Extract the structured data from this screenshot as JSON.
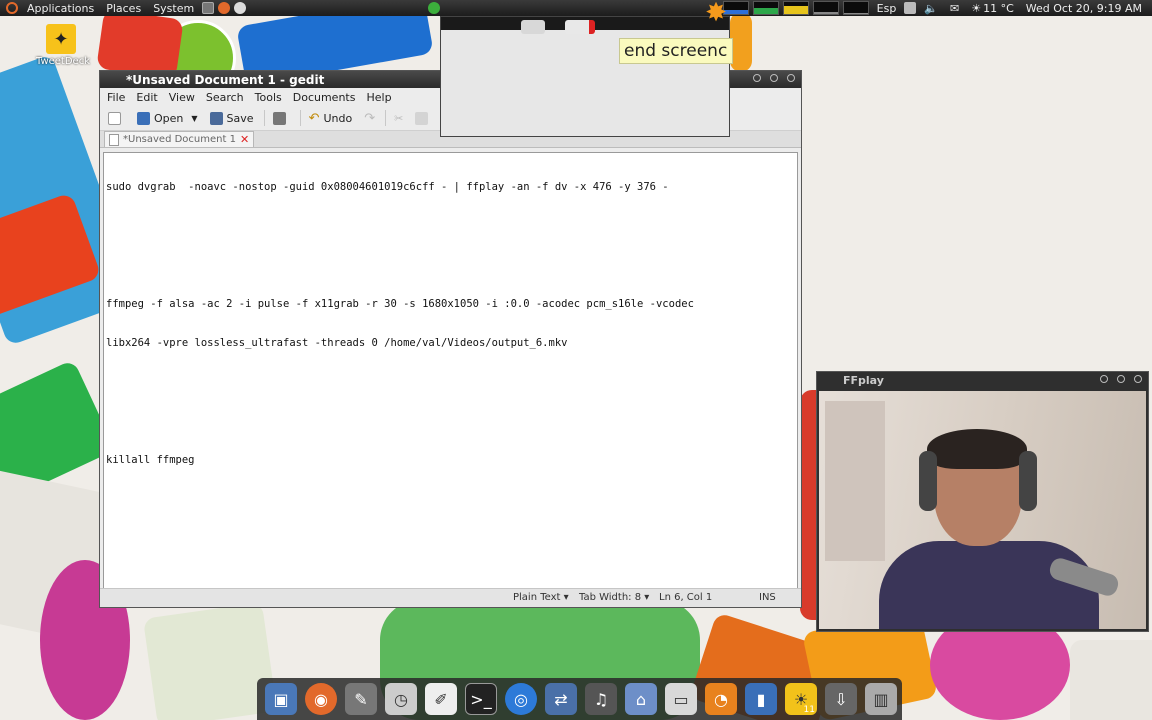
{
  "top_panel": {
    "menus": [
      "Applications",
      "Places",
      "System"
    ],
    "keyboard_layout": "Esp",
    "weather": "11 °C",
    "datetime": "Wed Oct 20,  9:19 AM"
  },
  "desktop": {
    "icons": [
      {
        "label": "TweetDeck",
        "icon": "tweetdeck-bird-icon"
      }
    ]
  },
  "gedit": {
    "title": "*Unsaved Document 1 - gedit",
    "menu": [
      "File",
      "Edit",
      "View",
      "Search",
      "Tools",
      "Documents",
      "Help"
    ],
    "toolbar": {
      "open_label": "Open",
      "save_label": "Save",
      "undo_label": "Undo"
    },
    "tab_label": "*Unsaved Document 1",
    "lines": [
      "sudo dvgrab  -noavc -nostop -guid 0x08004601019c6cff - | ffplay -an -f dv -x 476 -y 376 -",
      "",
      "",
      "ffmpeg -f alsa -ac 2 -i pulse -f x11grab -r 30 -s 1680x1050 -i :0.0 -acodec pcm_s16le -vcodec",
      "libx264 -vpre lossless_ultrafast -threads 0 /home/val/Videos/output_6.mkv",
      "",
      "",
      "killall ffmpeg"
    ],
    "status": {
      "language": "Plain Text",
      "tab_width": "Tab Width:  8",
      "position": "Ln 6, Col 1",
      "mode": "INS"
    }
  },
  "screencast_overlay": {
    "label": "end screenc"
  },
  "ffplay": {
    "title": "FFplay"
  },
  "dock": {
    "items": [
      {
        "icon": "save-disk-icon"
      },
      {
        "icon": "firefox-icon"
      },
      {
        "icon": "gimp-icon"
      },
      {
        "icon": "time-tracker-icon"
      },
      {
        "icon": "text-editor-icon"
      },
      {
        "icon": "terminal-icon"
      },
      {
        "icon": "chromium-icon"
      },
      {
        "icon": "network-icon"
      },
      {
        "icon": "headphones-icon"
      },
      {
        "icon": "home-folder-icon"
      },
      {
        "icon": "window-icon"
      },
      {
        "icon": "rss-icon"
      },
      {
        "icon": "notebook-icon"
      },
      {
        "icon": "weather-icon",
        "badge": "11"
      },
      {
        "icon": "download-icon"
      },
      {
        "icon": "trash-icon"
      }
    ]
  },
  "colors": {
    "panel": "#1c1c1c",
    "titlebar": "#2a2a2a",
    "accent_orange": "#e2692b"
  }
}
